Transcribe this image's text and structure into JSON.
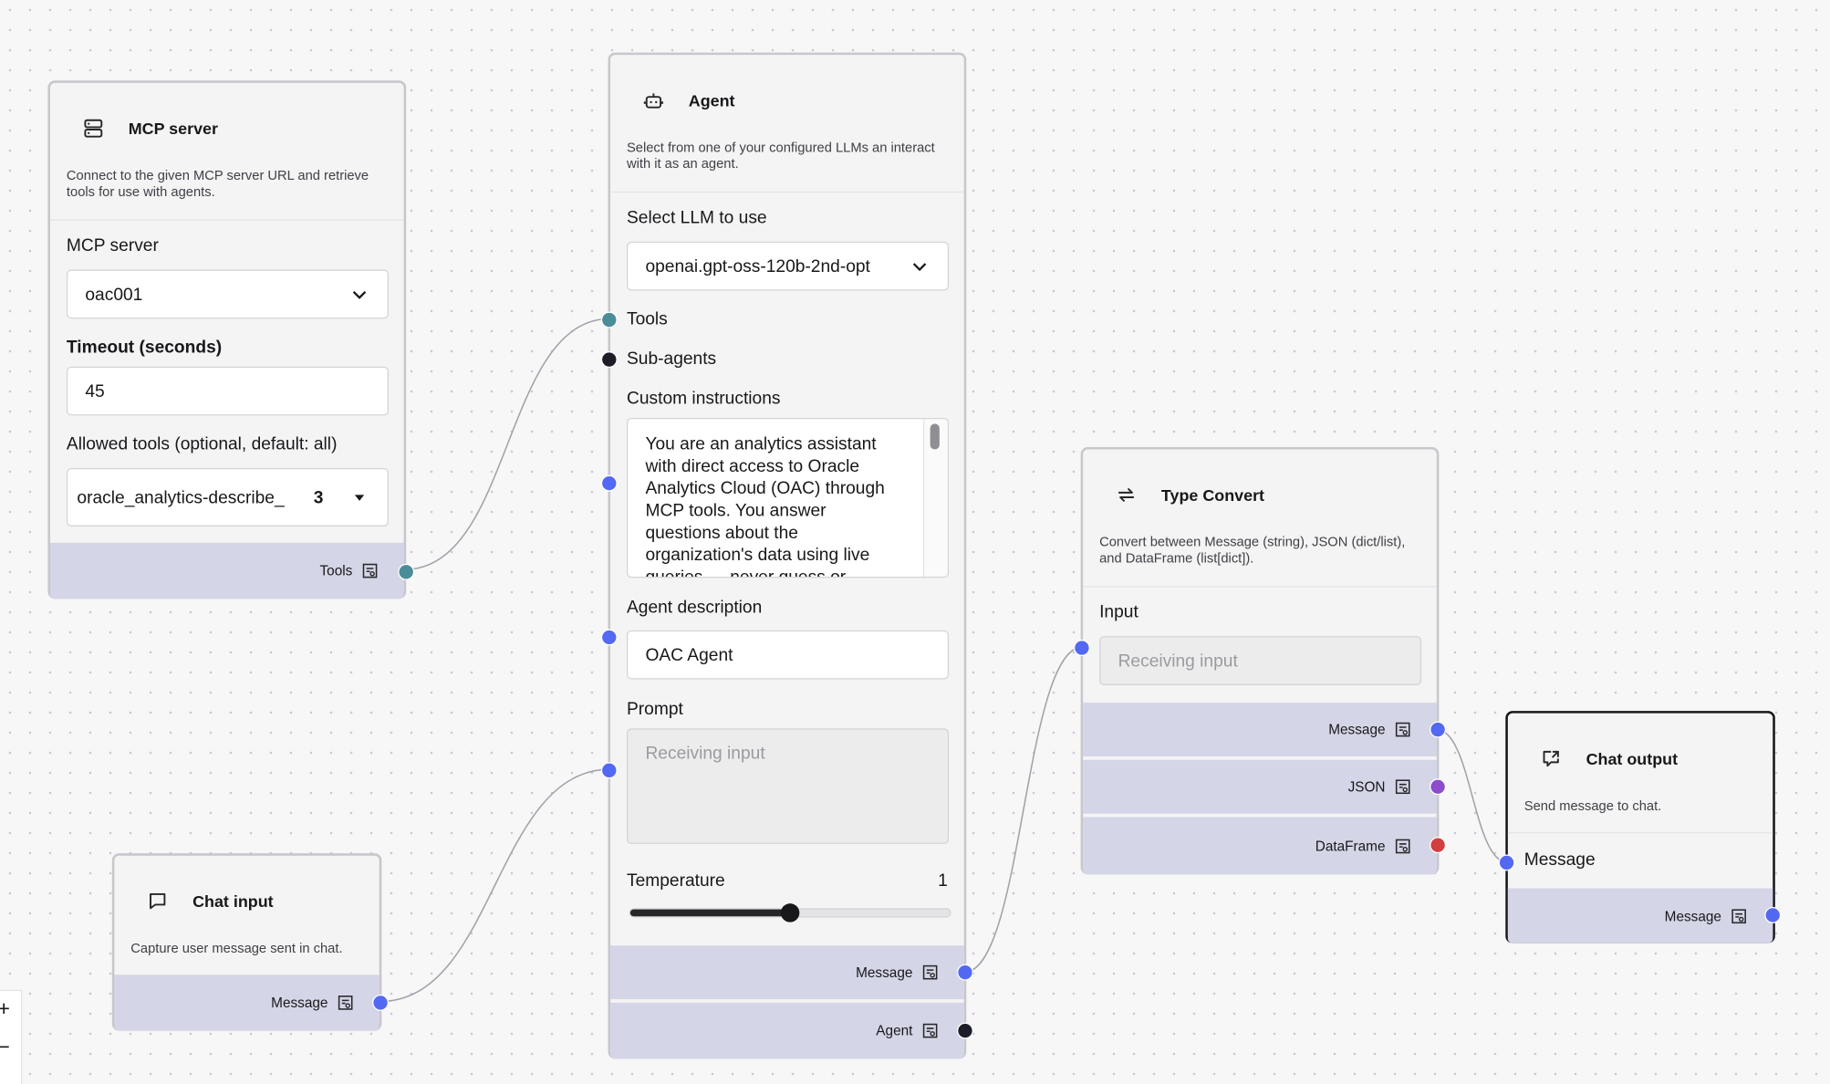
{
  "colors": {
    "handle_tools": "#4a8d99",
    "handle_message": "#5469f2",
    "handle_agent": "#1c1d27",
    "handle_json": "#8c4ccc",
    "handle_dataframe": "#d33f3f",
    "footer_bg": "#d4d5e6"
  },
  "mcp_node": {
    "icon": "server-icon",
    "title": "MCP server",
    "description": "Connect to the given MCP server URL and retrieve tools for use with agents.",
    "server_label": "MCP server",
    "server_value": "oac001",
    "timeout_label": "Timeout (seconds)",
    "timeout_value": "45",
    "allowed_label": "Allowed tools (optional, default: all)",
    "allowed_value": "oracle_analytics-describe_",
    "allowed_count": "3",
    "output_label": "Tools"
  },
  "chat_input_node": {
    "icon": "chat-bubble-icon",
    "title": "Chat input",
    "description": "Capture user message sent in chat.",
    "output_label": "Message"
  },
  "agent_node": {
    "icon": "bot-icon",
    "title": "Agent",
    "description": "Select from one of your configured LLMs an interact with it as an agent.",
    "llm_label": "Select LLM to use",
    "llm_value": "openai.gpt-oss-120b-2nd-opt",
    "tools_label": "Tools",
    "subagents_label": "Sub-agents",
    "instructions_label": "Custom instructions",
    "instructions_value": "You are an analytics assistant with direct access to Oracle Analytics Cloud (OAC) through MCP tools. You answer questions about the organization's data using live queries — never guess or",
    "description_label": "Agent description",
    "description_value": "OAC Agent",
    "prompt_label": "Prompt",
    "prompt_placeholder": "Receiving input",
    "temperature_label": "Temperature",
    "temperature_value": "1",
    "temperature_fraction": 0.5,
    "output_message_label": "Message",
    "output_agent_label": "Agent"
  },
  "type_convert_node": {
    "icon": "convert-arrows-icon",
    "title": "Type Convert",
    "description": "Convert between Message (string), JSON (dict/list), and DataFrame (list[dict]).",
    "input_label": "Input",
    "input_placeholder": "Receiving input",
    "output_message_label": "Message",
    "output_json_label": "JSON",
    "output_dataframe_label": "DataFrame"
  },
  "chat_output_node": {
    "icon": "chat-output-icon",
    "title": "Chat output",
    "description": "Send message to chat.",
    "input_label": "Message",
    "output_label": "Message"
  },
  "zoom_controls": {
    "zoom_in": "+",
    "zoom_out": "−"
  }
}
